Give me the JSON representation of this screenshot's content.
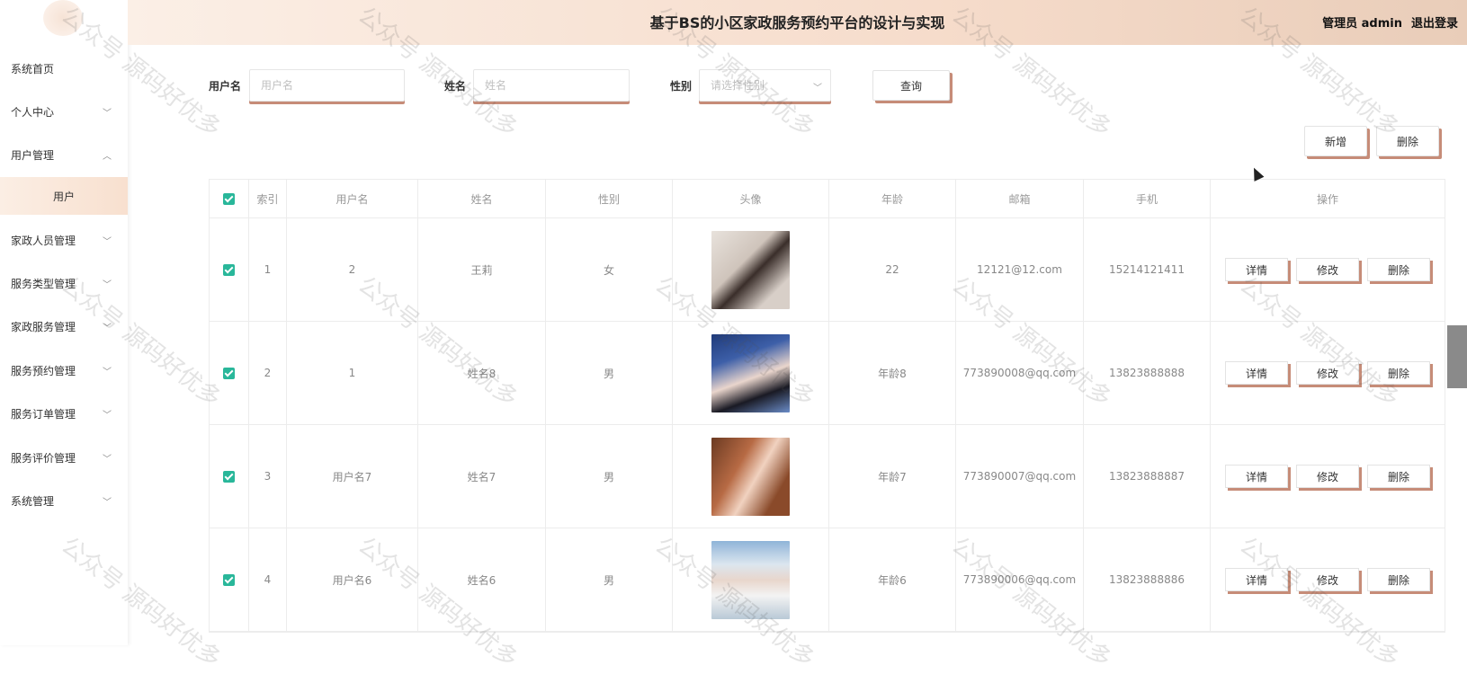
{
  "header": {
    "title": "基于BS的小区家政服务预约平台的设计与实现",
    "user": "管理员 admin",
    "logout": "退出登录"
  },
  "sidebar": {
    "items": [
      {
        "label": "系统首页"
      },
      {
        "label": "个人中心"
      },
      {
        "label": "用户管理"
      },
      {
        "label": "用户"
      },
      {
        "label": "家政人员管理"
      },
      {
        "label": "服务类型管理"
      },
      {
        "label": "家政服务管理"
      },
      {
        "label": "服务预约管理"
      },
      {
        "label": "服务订单管理"
      },
      {
        "label": "服务评价管理"
      },
      {
        "label": "系统管理"
      }
    ]
  },
  "search": {
    "username_label": "用户名",
    "username_placeholder": "用户名",
    "name_label": "姓名",
    "name_placeholder": "姓名",
    "gender_label": "性别",
    "gender_placeholder": "请选择性别",
    "query_button": "查询"
  },
  "actions": {
    "add_button": "新增",
    "delete_button": "删除"
  },
  "table": {
    "headers": [
      "索引",
      "用户名",
      "姓名",
      "性别",
      "头像",
      "年龄",
      "邮箱",
      "手机",
      "操作"
    ],
    "rows": [
      {
        "index": "1",
        "username": "2",
        "name": "王莉",
        "gender": "女",
        "age": "22",
        "email": "12121@12.com",
        "phone": "15214121411"
      },
      {
        "index": "2",
        "username": "1",
        "name": "姓名8",
        "gender": "男",
        "age": "年龄8",
        "email": "773890008@qq.com",
        "phone": "13823888888"
      },
      {
        "index": "3",
        "username": "用户名7",
        "name": "姓名7",
        "gender": "男",
        "age": "年龄7",
        "email": "773890007@qq.com",
        "phone": "13823888887"
      },
      {
        "index": "4",
        "username": "用户名6",
        "name": "姓名6",
        "gender": "男",
        "age": "年龄6",
        "email": "773890006@qq.com",
        "phone": "13823888886"
      }
    ],
    "row_buttons": {
      "detail": "详情",
      "edit": "修改",
      "delete": "删除"
    }
  },
  "watermark": "公众号 源码好优多",
  "colors": {
    "accent_shadow": "#c68c78",
    "checkbox": "#29b79a",
    "header_gradient_end": "#e9cdb9"
  }
}
